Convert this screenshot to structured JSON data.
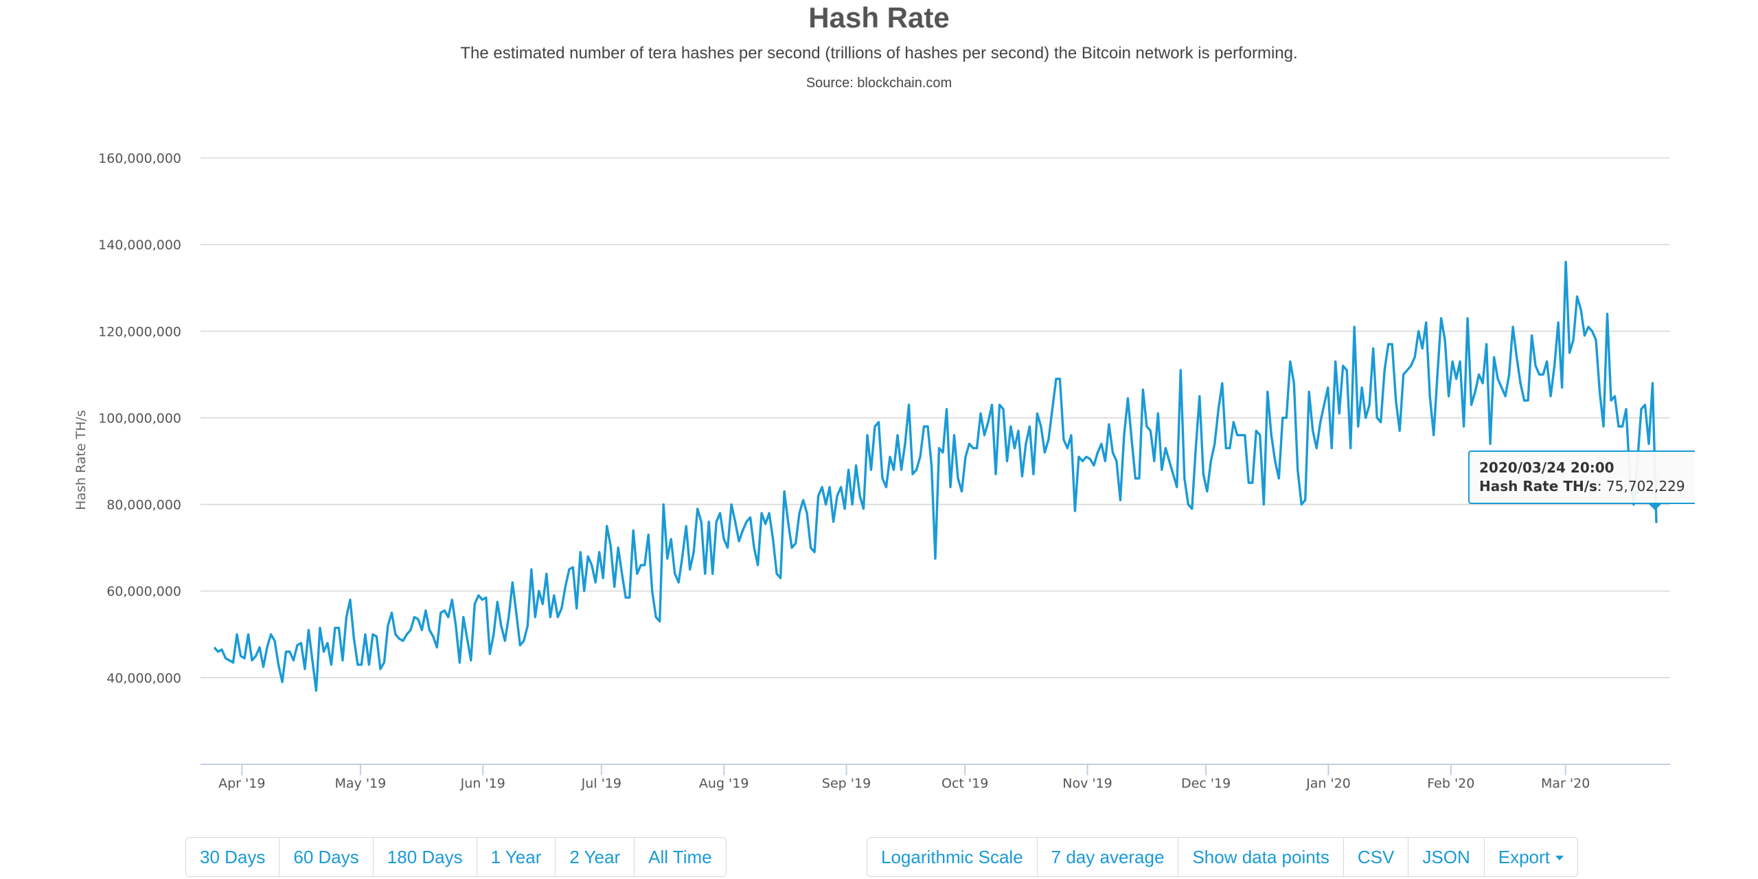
{
  "header": {
    "title": "Hash Rate",
    "subtitle": "The estimated number of tera hashes per second (trillions of hashes per second) the Bitcoin network is performing.",
    "source": "Source: blockchain.com"
  },
  "tooltip": {
    "date": "2020/03/24 20:00",
    "label": "Hash Rate TH/s",
    "value": "75,702,229"
  },
  "range_buttons": [
    "30 Days",
    "60 Days",
    "180 Days",
    "1 Year",
    "2 Year",
    "All Time"
  ],
  "option_buttons": {
    "log": "Logarithmic Scale",
    "avg": "7 day average",
    "points": "Show data points",
    "csv": "CSV",
    "json": "JSON",
    "export": "Export"
  },
  "colors": {
    "series": "#1a9ad6",
    "accent": "#1a9ad6"
  },
  "chart_data": {
    "type": "line",
    "title": "Hash Rate",
    "subtitle": "The estimated number of tera hashes per second (trillions of hashes per second) the Bitcoin network is performing.",
    "xlabel": "",
    "ylabel": "Hash Rate TH/s",
    "ylim": [
      20000000,
      160000000
    ],
    "yticks": [
      40000000,
      60000000,
      80000000,
      100000000,
      120000000,
      140000000,
      160000000
    ],
    "ytick_labels": [
      "40,000,000",
      "60,000,000",
      "80,000,000",
      "100,000,000",
      "120,000,000",
      "140,000,000",
      "160,000,000"
    ],
    "xticks": [
      "Apr '19",
      "May '19",
      "Jun '19",
      "Jul '19",
      "Aug '19",
      "Sep '19",
      "Oct '19",
      "Nov '19",
      "Dec '19",
      "Jan '20",
      "Feb '20",
      "Mar '20"
    ],
    "x_start": "2019-03-25",
    "x_end": "2020-03-24",
    "grid": true,
    "legend": "none",
    "series": [
      {
        "name": "Hash Rate TH/s",
        "values_millions": [
          47,
          46,
          46.5,
          44.5,
          44,
          43.5,
          50,
          45,
          44.5,
          50,
          44,
          45,
          47,
          42.5,
          47,
          50,
          48.5,
          43,
          39,
          46,
          46,
          44,
          47.5,
          48,
          42,
          51,
          44,
          37,
          51.5,
          46,
          48,
          43,
          51.5,
          51.5,
          44,
          54,
          58,
          49,
          43,
          43,
          50,
          43,
          50,
          49.5,
          42,
          43.5,
          52,
          55,
          50,
          49,
          48.5,
          50,
          51,
          54,
          53.5,
          51,
          55.5,
          51,
          49.5,
          47,
          55,
          55.5,
          54,
          58,
          52,
          43.5,
          54,
          49,
          44,
          57,
          59,
          58,
          58.5,
          45.5,
          50,
          57.5,
          52,
          48.5,
          54,
          62,
          55,
          47.5,
          48.5,
          52,
          65,
          54,
          60,
          57,
          64,
          54,
          59,
          54,
          56,
          61,
          65,
          65.5,
          56,
          69,
          60,
          68,
          66,
          62,
          69,
          63,
          75,
          70.5,
          61,
          70,
          64,
          58.5,
          58.5,
          74,
          64,
          66,
          66,
          73,
          60,
          54,
          53,
          80,
          67.5,
          72,
          64,
          62,
          68,
          75,
          65,
          69,
          79,
          76,
          64,
          76,
          64,
          76,
          78,
          72,
          70,
          80,
          76,
          71.5,
          74,
          76,
          77,
          70,
          66,
          78,
          75.5,
          78,
          72,
          64,
          63,
          83,
          76,
          70,
          71,
          78,
          81,
          78,
          70,
          69,
          82,
          84,
          80,
          84,
          76,
          82,
          84,
          79,
          88,
          80,
          89,
          82,
          79,
          96,
          88,
          98,
          99,
          86,
          84,
          91,
          88,
          96,
          88,
          94,
          103,
          87,
          88,
          91,
          98,
          98,
          89,
          67.5,
          93,
          92,
          102,
          84,
          96,
          86,
          83,
          91,
          94,
          93,
          93,
          101,
          96,
          99,
          103,
          87,
          103,
          102,
          90,
          98,
          93,
          97,
          86.5,
          94,
          98,
          87,
          101,
          98,
          92,
          95,
          102,
          109,
          109,
          95,
          93,
          96,
          78.5,
          91,
          90,
          91,
          90.5,
          89,
          92,
          94,
          90,
          98.5,
          92,
          90,
          81,
          96,
          104.5,
          95,
          86,
          86,
          106.5,
          98,
          97,
          90,
          101,
          88,
          93,
          90,
          87,
          84,
          111,
          86,
          80,
          79,
          93,
          105,
          87,
          83,
          90,
          94,
          102,
          108,
          93,
          93,
          99,
          96,
          96,
          96,
          85,
          85,
          97,
          96,
          80,
          106,
          96,
          90,
          86,
          100,
          100,
          113,
          108,
          88,
          80,
          81,
          106,
          97,
          93,
          99,
          103,
          107,
          93,
          113,
          101,
          112,
          111,
          93,
          121,
          98,
          107,
          100,
          103,
          116,
          100,
          99,
          111,
          117,
          117,
          104,
          97,
          110,
          111,
          112,
          114,
          120,
          116,
          122,
          105,
          96,
          110,
          123,
          118,
          105,
          113,
          109,
          113,
          98,
          123,
          103,
          106,
          110,
          108,
          117,
          94,
          114,
          109,
          107,
          105,
          110,
          121,
          114,
          108,
          104,
          104,
          119,
          112,
          110,
          110,
          113,
          105,
          112,
          122,
          107,
          136,
          115,
          118,
          128,
          125,
          119,
          121,
          120,
          118,
          106,
          98,
          124,
          104,
          105,
          98,
          98,
          102,
          86,
          80,
          90,
          102,
          103,
          94,
          108,
          75.7
        ]
      }
    ]
  }
}
